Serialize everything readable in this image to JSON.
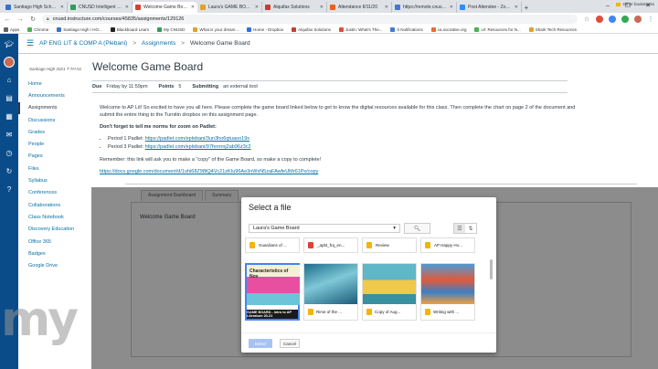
{
  "browser": {
    "tabs": [
      {
        "label": "Santiago High School Dela",
        "color": "#3a70c8"
      },
      {
        "label": "CNUSD Intelligent Hub",
        "color": "#2f9e5b"
      },
      {
        "label": "Welcome Game Board",
        "color": "#d8402c",
        "active": true
      },
      {
        "label": "Laura's GAME BOARD - Inte",
        "color": "#e1a22b"
      },
      {
        "label": "Alquifax Solutions",
        "color": "#c53e2f"
      },
      {
        "label": "Attendance 8/11/20",
        "color": "#e8621f"
      },
      {
        "label": "https://remote.cnusd.k12",
        "color": "#4179d3"
      },
      {
        "label": "Post Attendee - Zoom",
        "color": "#2d8cff"
      }
    ],
    "new_tab": "+",
    "url": "cnusd.instructure.com/courses/45835/assignments/129126",
    "bookmarks": [
      {
        "label": "Apps",
        "color": "#5f6368"
      },
      {
        "label": "Chrome",
        "color": "#4caf50"
      },
      {
        "label": "Santiago High / HO...",
        "color": "#3a70c8"
      },
      {
        "label": "Blackboard Learn",
        "color": "#222222"
      },
      {
        "label": "My CNUSD",
        "color": "#2f9e5b"
      },
      {
        "label": "What is your dream...",
        "color": "#e1a22b"
      },
      {
        "label": "Home - Dropbox",
        "color": "#2d6ff0"
      },
      {
        "label": "Alquifax Solutions",
        "color": "#c53e2f"
      },
      {
        "label": "Justin: What's The...",
        "color": "#e04d3b"
      },
      {
        "label": "0 Notifications",
        "color": "#4179d3"
      },
      {
        "label": "ca.socrative.org",
        "color": "#ee6b2d"
      },
      {
        "label": "UI: Resources for N...",
        "color": "#4caf50"
      },
      {
        "label": "Shark Tech Resources",
        "color": "#e1a22b"
      }
    ],
    "other_bookmarks": "Other bookmarks"
  },
  "breadcrumb": {
    "course": "AP ENG LIT & COMP A (Plebani)",
    "section": "Assignments",
    "current": "Welcome Game Board",
    "separator": ">"
  },
  "course_nav": {
    "term": "Santiago High 2021 T-TH-51",
    "items": [
      "Home",
      "Announcements",
      "Assignments",
      "Discussions",
      "Grades",
      "People",
      "Pages",
      "Files",
      "Syllabus",
      "Conferences",
      "Collaborations",
      "Class Notebook",
      "Discovery Education",
      "Office 365",
      "Badges",
      "Google Drive"
    ],
    "active": "Assignments"
  },
  "assignment": {
    "title": "Welcome Game Board",
    "due_label": "Due",
    "due_value": "Friday by 11:59pm",
    "points_label": "Points",
    "points_value": "5",
    "submitting_label": "Submitting",
    "submitting_value": "an external tool",
    "intro": "Welcome to AP Lit!  So excited to have you all here.  Please complete the game board linked below to get to know the digital resources available for this class.  Then complete the chart on page 2 of the document and submit the entire thing to the Turnitin dropbox on this assignment page.",
    "padlet_heading": "Don't forget to tell me norms for zoom on Padlet:",
    "period1_label": "Period 1 Padlet:",
    "period1_link": "https://padlet.com/eplebani/3un3ho6qtuaoo19x",
    "period3_label": "Period 3 Padlet:",
    "period3_link": "https://padlet.com/eplebani/97ferrnnj2ab96z3c2",
    "reminder": "Remember: this link will ask you to make a \"copy\" of the Game Board, so make a copy to complete!",
    "doc_link": "https://docs.google.com/document/d/1ohi68Z98tQ4Vc21zKIu96Ae3nWxN5zaFAwfeUMr61Ps/copy"
  },
  "submission": {
    "tabs": [
      "Assignment Dashboard",
      "Summary"
    ],
    "field": "Welcome Game Board"
  },
  "picker": {
    "title": "Select a file",
    "folder": "Laura's Game Board",
    "row1": [
      {
        "name": "Guardians of ...",
        "color": "#f4b400"
      },
      {
        "name": "_apbt_frq_en...",
        "color": "#db4437"
      },
      {
        "name": "Review",
        "color": "#f4b400"
      },
      {
        "name": "AP Happy Ho...",
        "color": "#f4b400"
      }
    ],
    "row2": [
      {
        "name": "GAME BOARD - Intro to AP Literature 20-21",
        "selected": true,
        "color": "#f4b400"
      },
      {
        "name": "Rime of the ...",
        "color": "#f4b400"
      },
      {
        "name": "Copy of Aug...",
        "color": "#f4b400"
      },
      {
        "name": "Writing with ...",
        "color": "#f4b400"
      }
    ],
    "thumb1_title": "Characteristics of Nov",
    "select_label": "Select",
    "cancel_label": "Cancel"
  },
  "watermark": "my"
}
